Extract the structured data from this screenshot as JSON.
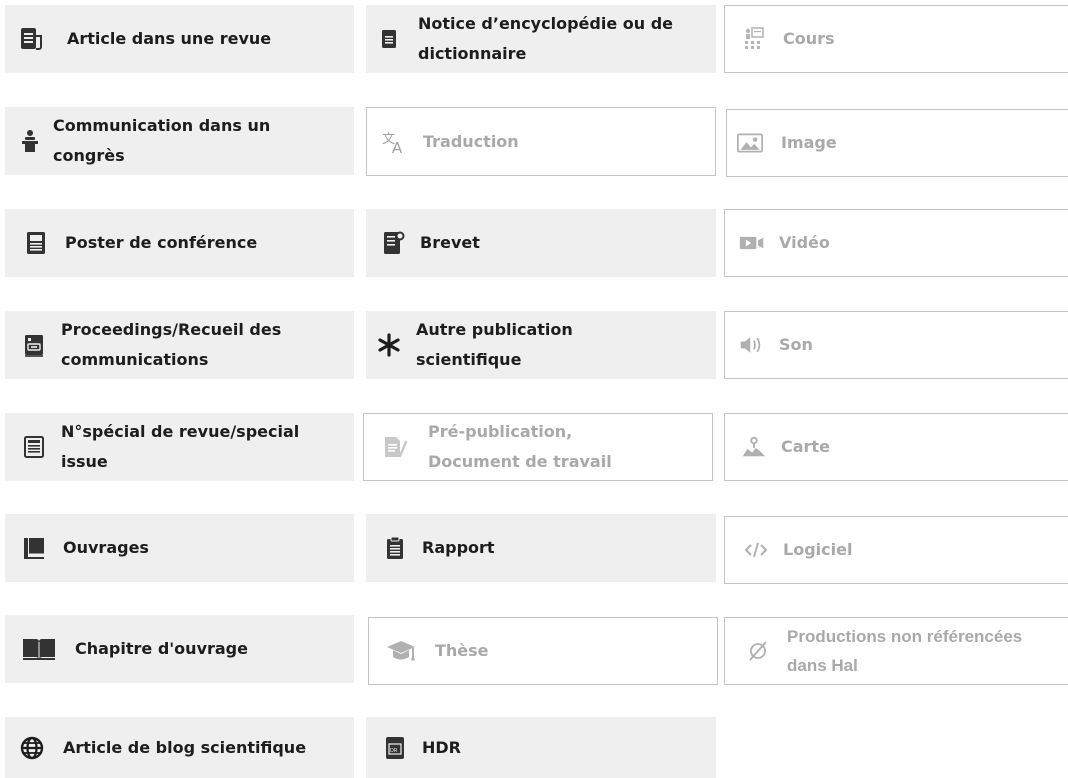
{
  "colors": {
    "active_bg": "#efefef",
    "active_text": "#1d1d1d",
    "inactive_text": "#a9a9a9",
    "inactive_border": "#c4c4c4"
  },
  "items": [
    {
      "label": "Article dans une revue",
      "icon": "article-journal-icon",
      "state": "active"
    },
    {
      "label": "Notice d’encyclopédie ou de dictionnaire",
      "icon": "encyclopedia-notice-icon",
      "state": "active"
    },
    {
      "label": "Cours",
      "icon": "course-icon",
      "state": "inactive"
    },
    {
      "label": "Communication dans un congrès",
      "icon": "speaker-podium-icon",
      "state": "active"
    },
    {
      "label": "Traduction",
      "icon": "translate-icon",
      "state": "inactive"
    },
    {
      "label": "Image",
      "icon": "image-icon",
      "state": "inactive"
    },
    {
      "label": "Poster de conférence",
      "icon": "poster-icon",
      "state": "active"
    },
    {
      "label": "Brevet",
      "icon": "patent-icon",
      "state": "active"
    },
    {
      "label": "Vidéo",
      "icon": "video-icon",
      "state": "inactive"
    },
    {
      "label": "Proceedings/Recueil des communications",
      "icon": "proceedings-icon",
      "state": "active"
    },
    {
      "label": "Autre publication scientifique",
      "icon": "asterisk-icon",
      "state": "active"
    },
    {
      "label": "Son",
      "icon": "sound-icon",
      "state": "inactive"
    },
    {
      "label": "N°spécial de revue/special issue",
      "icon": "special-issue-icon",
      "state": "active"
    },
    {
      "label": "Pré-publication, Document de travail",
      "icon": "preprint-icon",
      "state": "inactive"
    },
    {
      "label": "Carte",
      "icon": "map-icon",
      "state": "inactive"
    },
    {
      "label": "Ouvrages",
      "icon": "book-icon",
      "state": "active"
    },
    {
      "label": "Rapport",
      "icon": "report-icon",
      "state": "active"
    },
    {
      "label": "Logiciel",
      "icon": "code-icon",
      "state": "inactive"
    },
    {
      "label": "Chapitre d'ouvrage",
      "icon": "open-book-icon",
      "state": "active"
    },
    {
      "label": "Thèse",
      "icon": "graduation-cap-icon",
      "state": "inactive"
    },
    {
      "label": "Productions non référencées dans Hal",
      "icon": "empty-set-icon",
      "state": "inactive"
    },
    {
      "label": "Article de blog scientifique",
      "icon": "globe-icon",
      "state": "active"
    },
    {
      "label": "HDR",
      "icon": "hdr-icon",
      "state": "active"
    }
  ]
}
